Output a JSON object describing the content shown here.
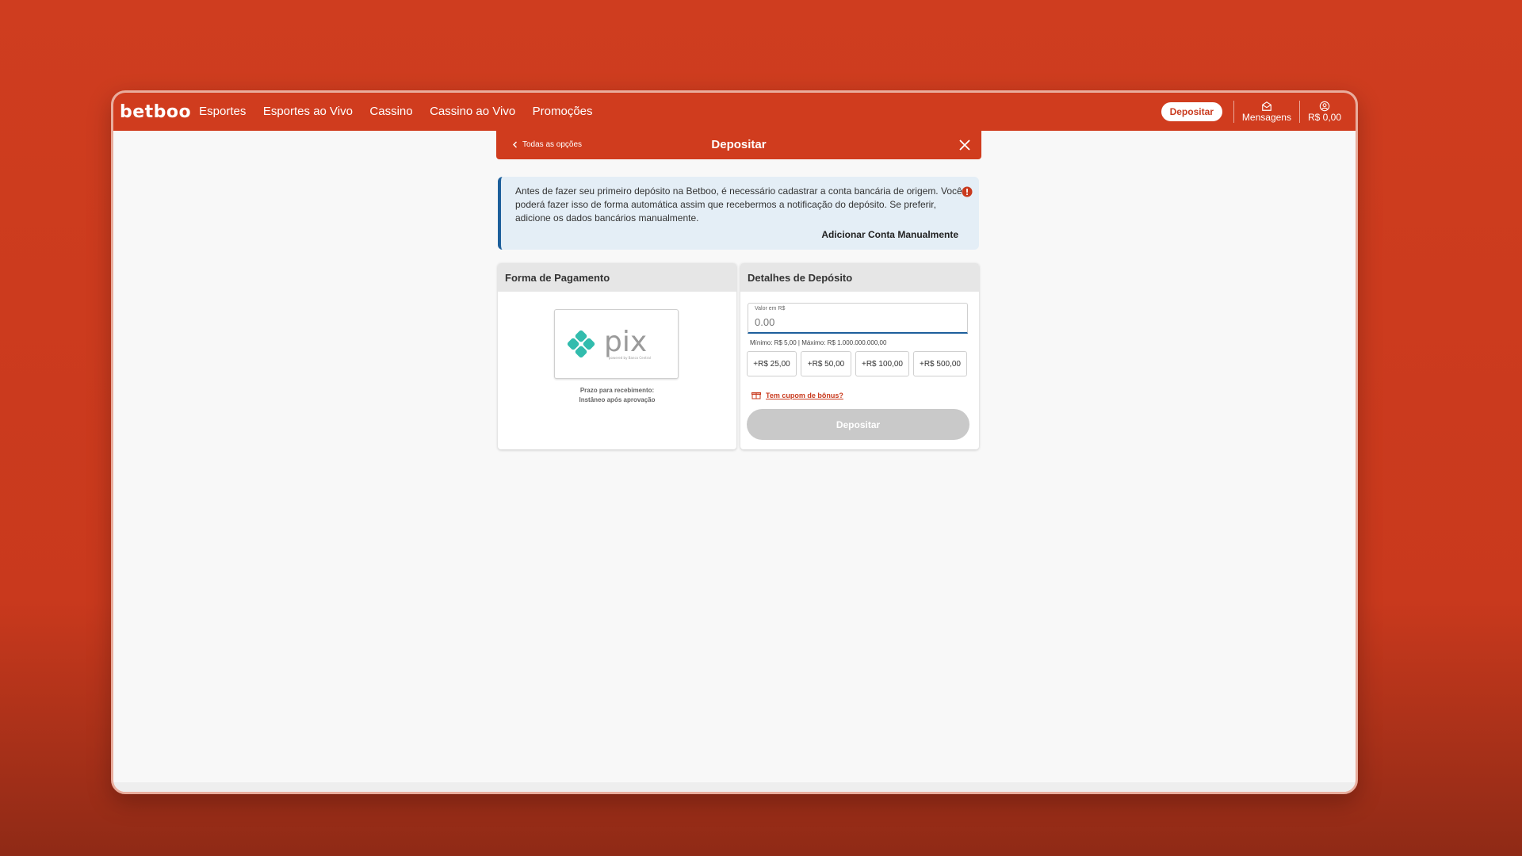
{
  "topbar": {
    "logo": "betboo",
    "nav": [
      "Esportes",
      "Esportes ao Vivo",
      "Cassino",
      "Cassino ao Vivo",
      "Promoções"
    ],
    "deposit_button": "Depositar",
    "messages_label": "Mensagens",
    "messages_icon": "envelope-icon",
    "balance_label": "R$ 0,00",
    "account_icon": "user-icon"
  },
  "modal": {
    "back_label": "Todas as opções",
    "title": "Depositar",
    "close_icon": "close-icon"
  },
  "info": {
    "text": "Antes de fazer seu primeiro depósito na Betboo, é necessário cadastrar a conta bancária de origem. Você poderá fazer isso de forma automática assim que recebermos a notificação do depósito. Se preferir, adicione os dados bancários manualmente.",
    "link": "Adicionar Conta Manualmente",
    "icon": "alert-icon"
  },
  "payment": {
    "header": "Forma de Pagamento",
    "method_logo_text": "pix",
    "method_logo_subtext": "powered by Banco Central",
    "prazo_line1": "Prazo para recebimento:",
    "prazo_line2": "Instâneo após aprovação"
  },
  "details": {
    "header": "Detalhes de Depósito",
    "amount_label": "Valor em R$",
    "amount_placeholder": "0.00",
    "limits": "Mínimo: R$ 5,00  |  Máximo: R$ 1.000.000.000,00",
    "quick_amounts": [
      "+R$ 25,00",
      "+R$ 50,00",
      "+R$ 100,00",
      "+R$ 500,00"
    ],
    "coupon_link": "Tem cupom de bônus?",
    "coupon_icon": "gift-icon",
    "submit_label": "Depositar"
  },
  "colors": {
    "brand": "#d03c1e",
    "info_bg": "#e4eef6",
    "info_accent": "#1d5f9b",
    "pix_teal": "#32bcad",
    "disabled": "#c9c9c9"
  }
}
